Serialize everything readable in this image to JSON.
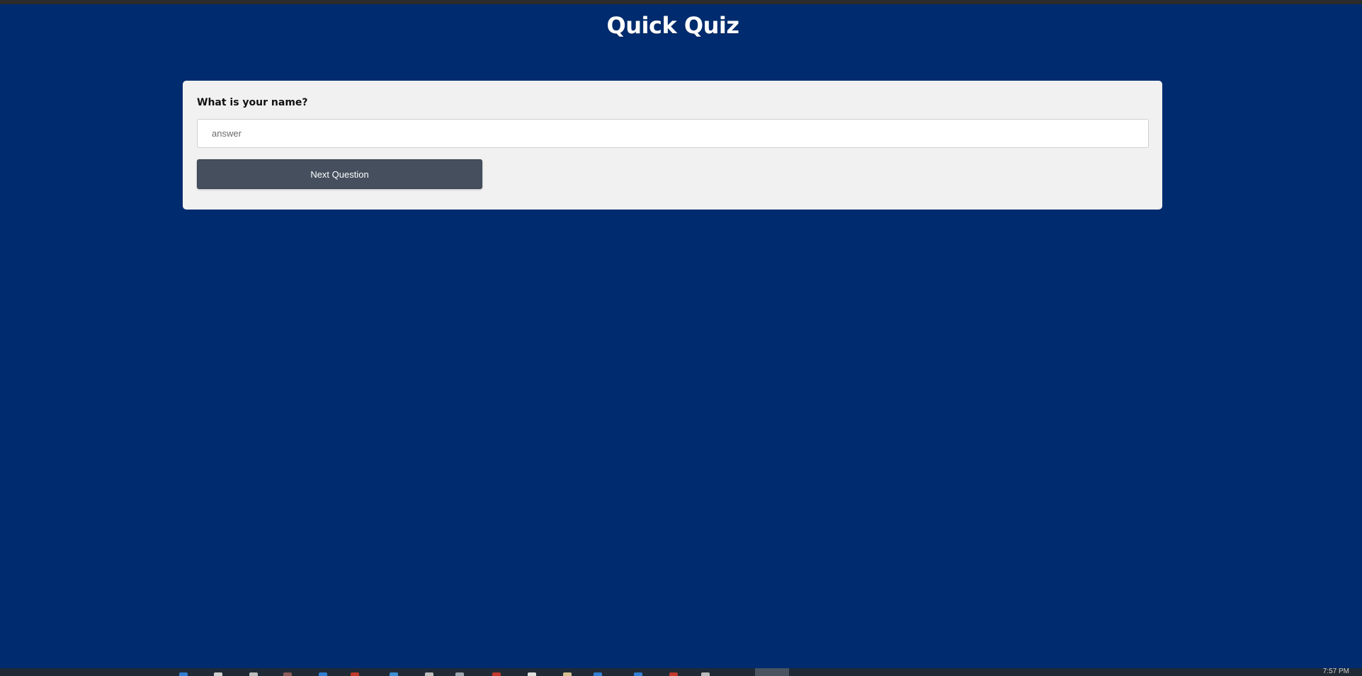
{
  "app": {
    "title": "Quick Quiz"
  },
  "quiz": {
    "question": "What is your name?",
    "answer_placeholder": "answer",
    "answer_value": "",
    "next_label": "Next Question"
  },
  "taskbar": {
    "clock": "7:57 PM",
    "icons": [
      {
        "name": "edge-icon",
        "color": "#2f7fd4"
      },
      {
        "name": "pin-icon",
        "color": "#cfcfcf"
      },
      {
        "name": "app-icon-3",
        "color": "#bdbdbd"
      },
      {
        "name": "app-icon-4",
        "color": "#8b5a5a"
      },
      {
        "name": "app-icon-5",
        "color": "#2f7fd4"
      },
      {
        "name": "app-icon-6",
        "color": "#c0392b"
      },
      {
        "name": "app-icon-7",
        "color": "#3a8fd6"
      },
      {
        "name": "app-icon-8",
        "color": "#bdbdbd"
      },
      {
        "name": "app-icon-9",
        "color": "#9aa4ae"
      },
      {
        "name": "app-icon-10",
        "color": "#c0392b"
      },
      {
        "name": "app-icon-11",
        "color": "#e0e0e0"
      },
      {
        "name": "app-icon-12",
        "color": "#d6c08f"
      },
      {
        "name": "app-icon-13",
        "color": "#2f7fd4"
      },
      {
        "name": "app-icon-14",
        "color": "#2f7fd4"
      },
      {
        "name": "app-icon-15",
        "color": "#c0392b"
      },
      {
        "name": "app-icon-16",
        "color": "#bdbdbd"
      }
    ]
  },
  "colors": {
    "background": "#002b6e",
    "card": "#f1f1f1",
    "button": "#454f5e"
  }
}
